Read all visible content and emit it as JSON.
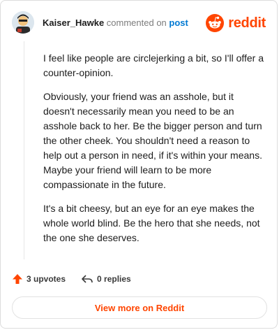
{
  "header": {
    "author": "Kaiser_Hawke",
    "action": "commented on",
    "post_link": "post",
    "brand": "reddit"
  },
  "comment": {
    "paragraphs": [
      "I feel like people are circlejerking a bit, so I'll offer a counter-opinion.",
      "Obviously, your friend was an asshole, but it doesn't necessarily mean you need to be an asshole back to her. Be the bigger person and turn the other cheek. You shouldn't need a reason to help out a person in need, if it's within your means. Maybe your friend will learn to be more compassionate in the future.",
      "It's a bit cheesy, but an eye for an eye makes the whole world blind. Be the hero that she needs, not the one she deserves."
    ]
  },
  "footer": {
    "upvotes": "3 upvotes",
    "replies": "0 replies",
    "view_more": "View more on Reddit"
  },
  "icons": {
    "upvote": "upvote-arrow-icon",
    "reply": "reply-arrow-icon",
    "brand": "reddit-logo-icon",
    "avatar": "user-avatar"
  },
  "colors": {
    "brand": "#ff4500",
    "link": "#0079d3",
    "text": "#1c1c1c",
    "muted": "#7c7c7c"
  }
}
